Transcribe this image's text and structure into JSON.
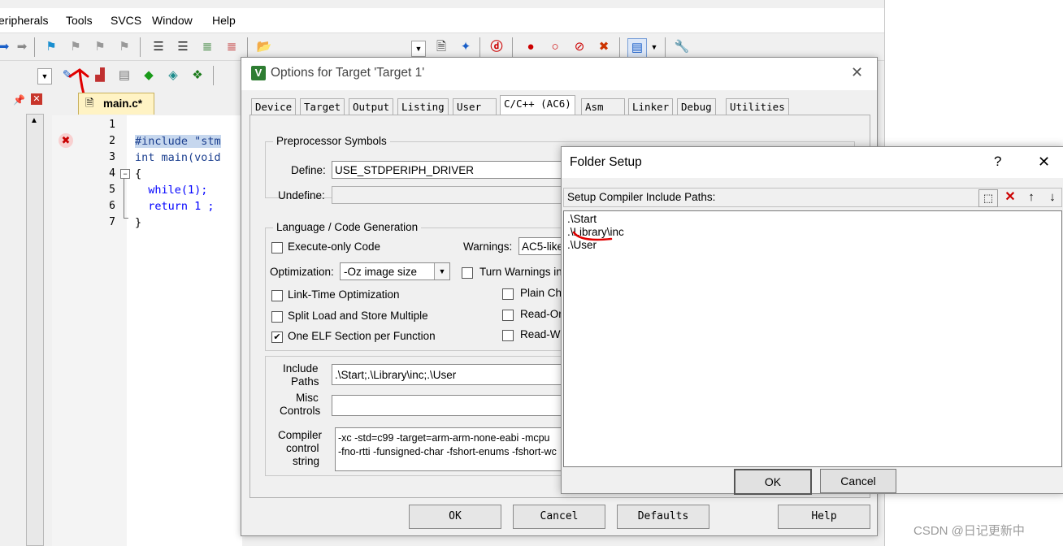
{
  "menubar": {
    "items": [
      "eripherals",
      "Tools",
      "SVCS",
      "Window",
      "Help"
    ]
  },
  "editor": {
    "tab_label": "main.c*",
    "line_numbers": [
      "1",
      "2",
      "3",
      "4",
      "5",
      "6",
      "7"
    ],
    "lines": [
      "",
      "#include \"stm",
      "int main(void",
      "{",
      "  while(1);",
      "  return 1 ;",
      "}"
    ]
  },
  "options_dialog": {
    "title": "Options for Target 'Target 1'",
    "tabs": [
      "Device",
      "Target",
      "Output",
      "Listing",
      "User",
      "C/C++ (AC6)",
      "Asm",
      "Linker",
      "Debug",
      "Utilities"
    ],
    "active_tab": "C/C++ (AC6)",
    "preprocessor": {
      "group_label": "Preprocessor Symbols",
      "define_label": "Define:",
      "define_value": "USE_STDPERIPH_DRIVER",
      "undefine_label": "Undefine:"
    },
    "language": {
      "group_label": "Language / Code Generation",
      "execute_only": "Execute-only Code",
      "warnings_label": "Warnings:",
      "warnings_value": "AC5-like",
      "optimization_label": "Optimization:",
      "optimization_value": "-Oz image size",
      "turn_warnings": "Turn Warnings in",
      "link_time": "Link-Time Optimization",
      "plain_char": "Plain Cha",
      "split_load": "Split Load and Store Multiple",
      "read_only": "Read-On",
      "one_elf": "One ELF Section per Function",
      "read_write": "Read-W"
    },
    "include_label_1": "Include",
    "include_label_2": "Paths",
    "include_value": ".\\Start;.\\Library\\inc;.\\User",
    "misc_label_1": "Misc",
    "misc_label_2": "Controls",
    "compiler_label_1": "Compiler",
    "compiler_label_2": "control",
    "compiler_label_3": "string",
    "compiler_line_1": "-xc -std=c99 -target=arm-arm-none-eabi -mcpu",
    "compiler_line_2": "-fno-rtti -funsigned-char -fshort-enums -fshort-wc",
    "buttons": {
      "ok": "OK",
      "cancel": "Cancel",
      "defaults": "Defaults",
      "help": "Help"
    }
  },
  "folder_setup": {
    "title": "Folder Setup",
    "help_glyph": "?",
    "header_label": "Setup Compiler Include Paths:",
    "paths": [
      ".\\Start",
      ".\\Library\\inc",
      ".\\User"
    ],
    "ok": "OK",
    "cancel": "Cancel"
  },
  "watermark": "CSDN @日记更新中",
  "colors": {
    "accent_red": "#cc0000",
    "keyword_blue": "#0000ff",
    "highlight": "#c6d7ee"
  }
}
